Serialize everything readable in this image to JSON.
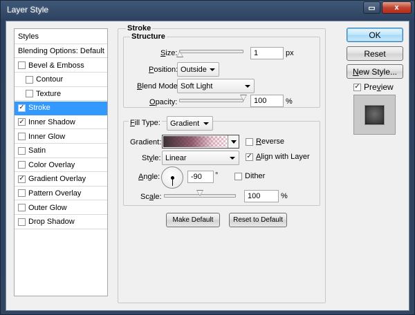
{
  "window": {
    "title": "Layer Style",
    "restore_icon": "restore-window-icon",
    "close_icon": "close-icon",
    "close_glyph": "x",
    "restore_glyph": "▭"
  },
  "styles_panel": {
    "header": "Styles",
    "blending_options": "Blending Options: Default",
    "items": [
      {
        "label": "Bevel & Emboss",
        "checked": false,
        "sub": false,
        "selected": false
      },
      {
        "label": "Contour",
        "checked": false,
        "sub": true,
        "selected": false
      },
      {
        "label": "Texture",
        "checked": false,
        "sub": true,
        "selected": false
      },
      {
        "label": "Stroke",
        "checked": true,
        "sub": false,
        "selected": true
      },
      {
        "label": "Inner Shadow",
        "checked": true,
        "sub": false,
        "selected": false
      },
      {
        "label": "Inner Glow",
        "checked": false,
        "sub": false,
        "selected": false
      },
      {
        "label": "Satin",
        "checked": false,
        "sub": false,
        "selected": false
      },
      {
        "label": "Color Overlay",
        "checked": false,
        "sub": false,
        "selected": false
      },
      {
        "label": "Gradient Overlay",
        "checked": true,
        "sub": false,
        "selected": false
      },
      {
        "label": "Pattern Overlay",
        "checked": false,
        "sub": false,
        "selected": false
      },
      {
        "label": "Outer Glow",
        "checked": false,
        "sub": false,
        "selected": false
      },
      {
        "label": "Drop Shadow",
        "checked": false,
        "sub": false,
        "selected": false
      }
    ]
  },
  "stroke": {
    "section_title": "Stroke",
    "structure_title": "Structure",
    "size": {
      "label_u": "S",
      "label_rest": "ize:",
      "value": "1",
      "unit": "px",
      "slider_fraction": 0.01
    },
    "position": {
      "label_u": "P",
      "label_rest": "osition:",
      "value": "Outside"
    },
    "blend_mode": {
      "label_u": "B",
      "label_rest": "lend Mode:",
      "value": "Soft Light"
    },
    "opacity": {
      "label_u": "O",
      "label_rest": "pacity:",
      "value": "100",
      "unit": "%",
      "slider_fraction": 1.0
    },
    "fill_type": {
      "label_u": "F",
      "label_rest": "ill Type:",
      "value": "Gradient"
    },
    "gradient": {
      "label": "Gradient:"
    },
    "reverse": {
      "label_u": "R",
      "label_rest": "everse",
      "checked": false
    },
    "style": {
      "label_pre": "St",
      "label_u": "y",
      "label_rest": "le:",
      "value": "Linear"
    },
    "align_with_layer": {
      "label_u": "A",
      "label_rest": "lign with Layer",
      "checked": true
    },
    "angle": {
      "label_u": "A",
      "label_rest": "ngle:",
      "value": "-90",
      "unit": "°"
    },
    "dither": {
      "label": "Dither",
      "checked": false
    },
    "scale": {
      "label_pre": "Sc",
      "label_u": "a",
      "label_rest": "le:",
      "value": "100",
      "unit": "%",
      "slider_fraction": 0.5
    }
  },
  "buttons": {
    "make_default": "Make Default",
    "reset_to_default": "Reset to Default",
    "ok": "OK",
    "reset": "Reset",
    "new_style": "New Style...",
    "new_style_u": "N",
    "new_style_rest": "ew Style...",
    "preview_label_pre": "Pre",
    "preview_label_u": "v",
    "preview_label_rest": "iew",
    "preview_checked": true
  },
  "check_glyph": "✓"
}
